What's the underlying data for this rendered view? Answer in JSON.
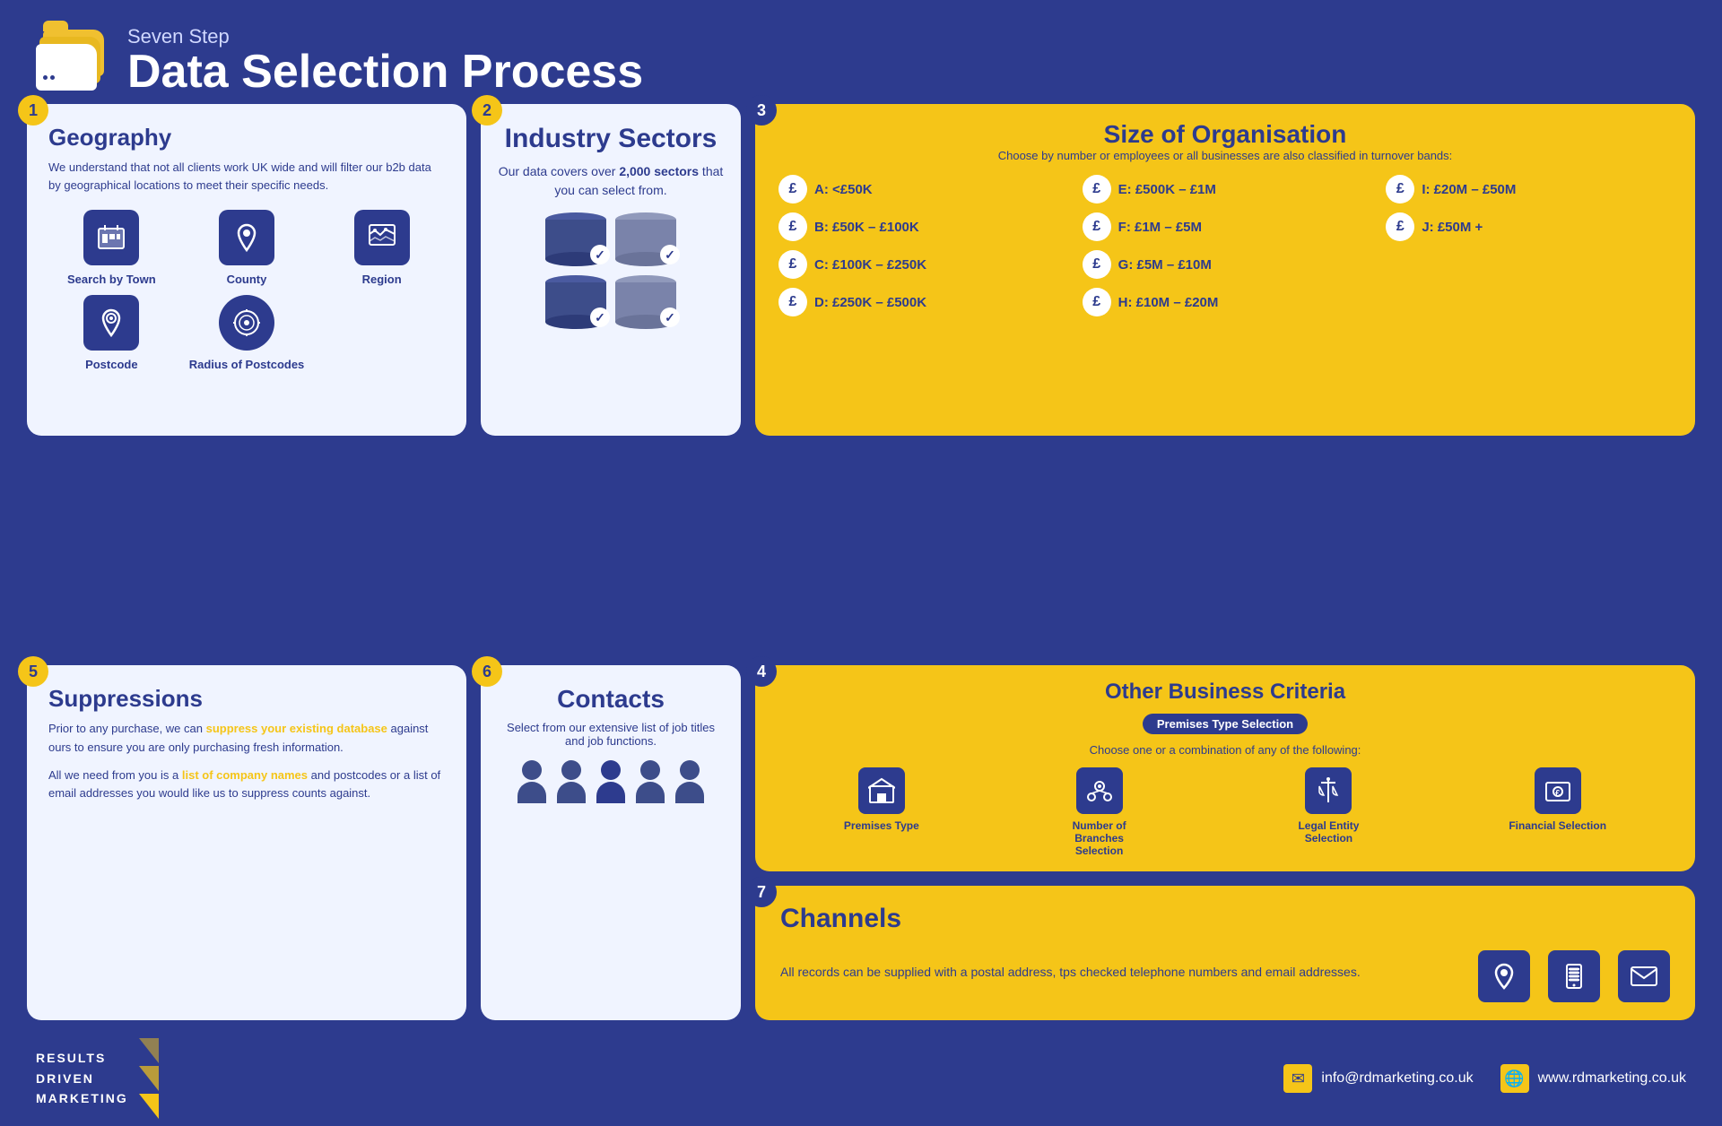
{
  "header": {
    "subtitle": "Seven Step",
    "title": "Data Selection Process",
    "icon_label": "folder-icon"
  },
  "steps": {
    "step1": {
      "number": "1",
      "title": "Geography",
      "body": "We understand that not all clients work UK wide and will filter our b2b data by geographical locations to meet their specific needs.",
      "geo_items": [
        {
          "label": "Search by Town",
          "icon": "🏙"
        },
        {
          "label": "County",
          "icon": "📍"
        },
        {
          "label": "Region",
          "icon": "🗺"
        },
        {
          "label": "Postcode",
          "icon": "📮"
        },
        {
          "label": "Radius of Postcodes",
          "icon": "🎯"
        }
      ]
    },
    "step2": {
      "number": "2",
      "title": "Industry Sectors",
      "subtitle_pre": "Our data covers over ",
      "subtitle_bold": "2,000 sectors",
      "subtitle_post": " that you can select from."
    },
    "step3": {
      "number": "3",
      "title": "Size of Organisation",
      "subtitle": "Choose by number or employees or all businesses are also classified in turnover bands:",
      "bands": [
        {
          "label": "A: <£50K"
        },
        {
          "label": "E: £500K – £1M"
        },
        {
          "label": "I: £20M – £50M"
        },
        {
          "label": "B: £50K – £100K"
        },
        {
          "label": "F: £1M – £5M"
        },
        {
          "label": "J: £50M +"
        },
        {
          "label": "C: £100K – £250K"
        },
        {
          "label": "G: £5M – £10M"
        },
        {
          "label": ""
        },
        {
          "label": "D: £250K – £500K"
        },
        {
          "label": "H: £10M – £20M"
        },
        {
          "label": ""
        }
      ]
    },
    "step4": {
      "number": "4",
      "title": "Other Business Criteria",
      "badge": "Premises Type Selection",
      "subtitle": "Choose one or a combination of any of the following:",
      "criteria": [
        {
          "label": "Premises Type",
          "icon": "🏢"
        },
        {
          "label": "Number of Branches Selection",
          "icon": "🗺"
        },
        {
          "label": "Legal Entity Selection",
          "icon": "⚖"
        },
        {
          "label": "Financial Selection",
          "icon": "💷"
        }
      ]
    },
    "step5": {
      "number": "5",
      "title": "Suppressions",
      "text1": "Prior to any purchase, we can ",
      "text1_link": "suppress your existing database",
      "text1_end": " against ours to ensure you are only purchasing fresh information.",
      "text2_pre": "All we need from you is a ",
      "text2_link": "list of company names",
      "text2_end": " and postcodes or a list of email addresses you would like us to suppress counts against."
    },
    "step6": {
      "number": "6",
      "title": "Contacts",
      "subtitle": "Select from our extensive list of job titles and job functions."
    },
    "step7": {
      "number": "7",
      "title": "Channels",
      "body": "All records can be supplied with a postal address, tps checked telephone numbers and email addresses.",
      "channel_icons": [
        "📍",
        "📞",
        "✉"
      ]
    }
  },
  "footer": {
    "logo_lines": [
      "RESULTS",
      "DRIVEN",
      "MARKETING"
    ],
    "email": "info@rdmarketing.co.uk",
    "website": "www.rdmarketing.co.uk"
  }
}
